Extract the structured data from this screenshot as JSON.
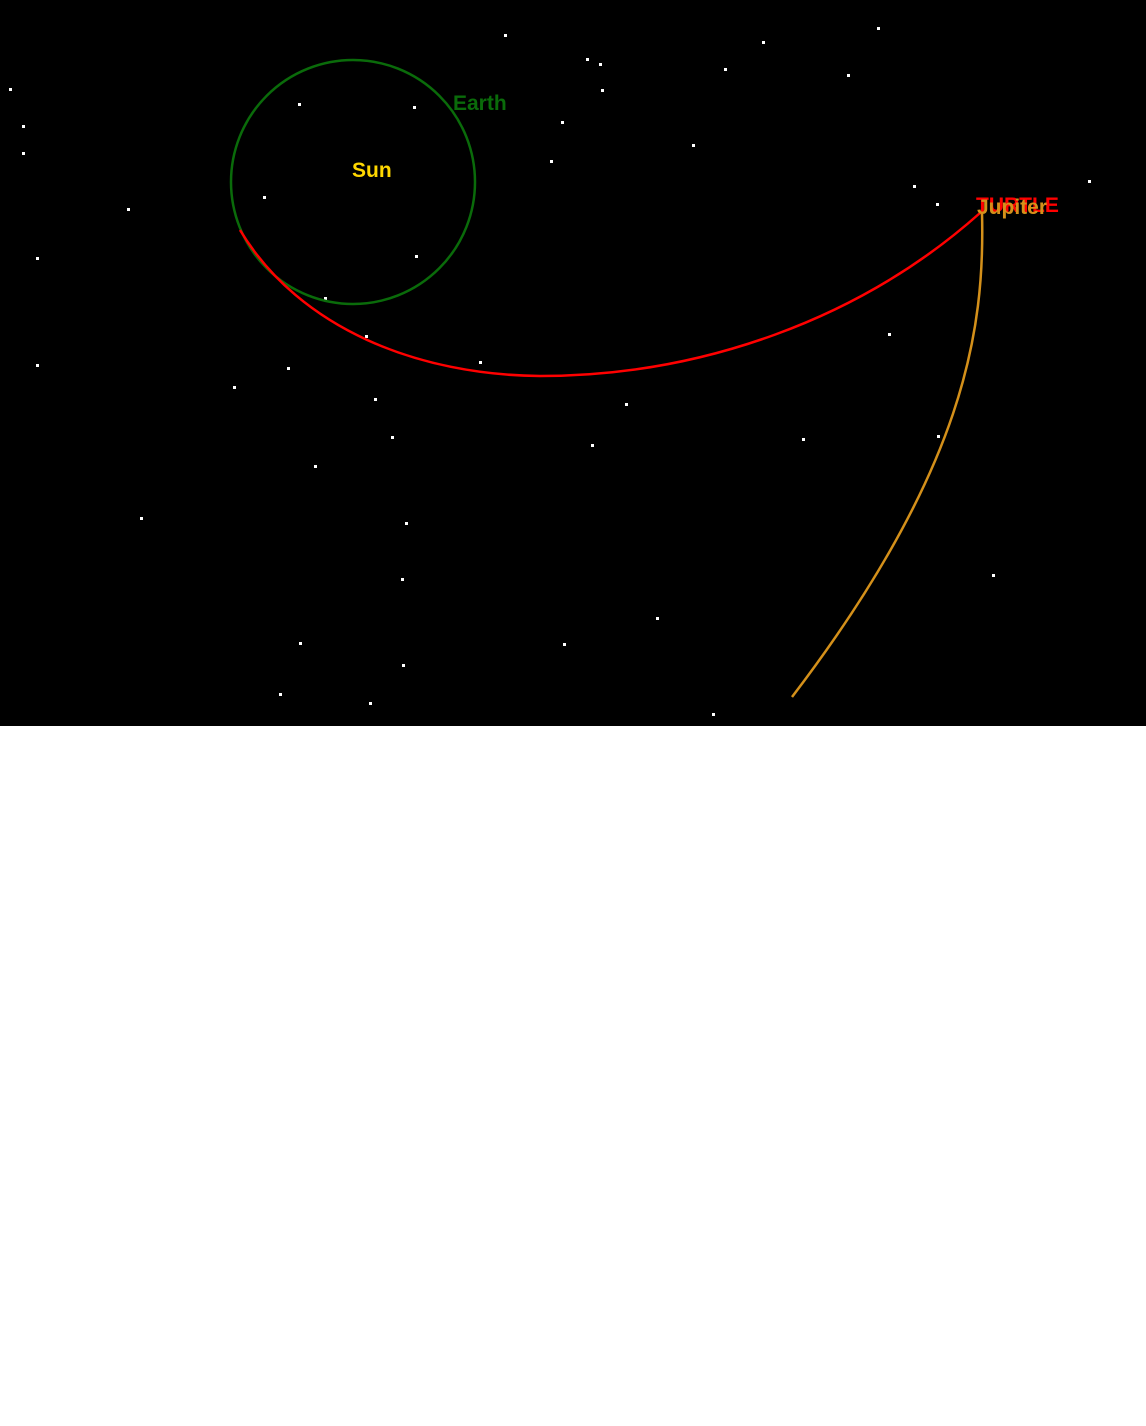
{
  "labels": {
    "sun": "Sun",
    "earth": "Earth",
    "probe": "TURTLE",
    "jupiter": "Jupiter"
  },
  "colors": {
    "background": "#000000",
    "stars": "#ffffff",
    "sun_label": "#ffd700",
    "earth_orbit": "#0a6b0a",
    "probe_trajectory": "#ff0000",
    "jupiter_orbit": "#d4901a",
    "below_area": "#ffffff"
  }
}
